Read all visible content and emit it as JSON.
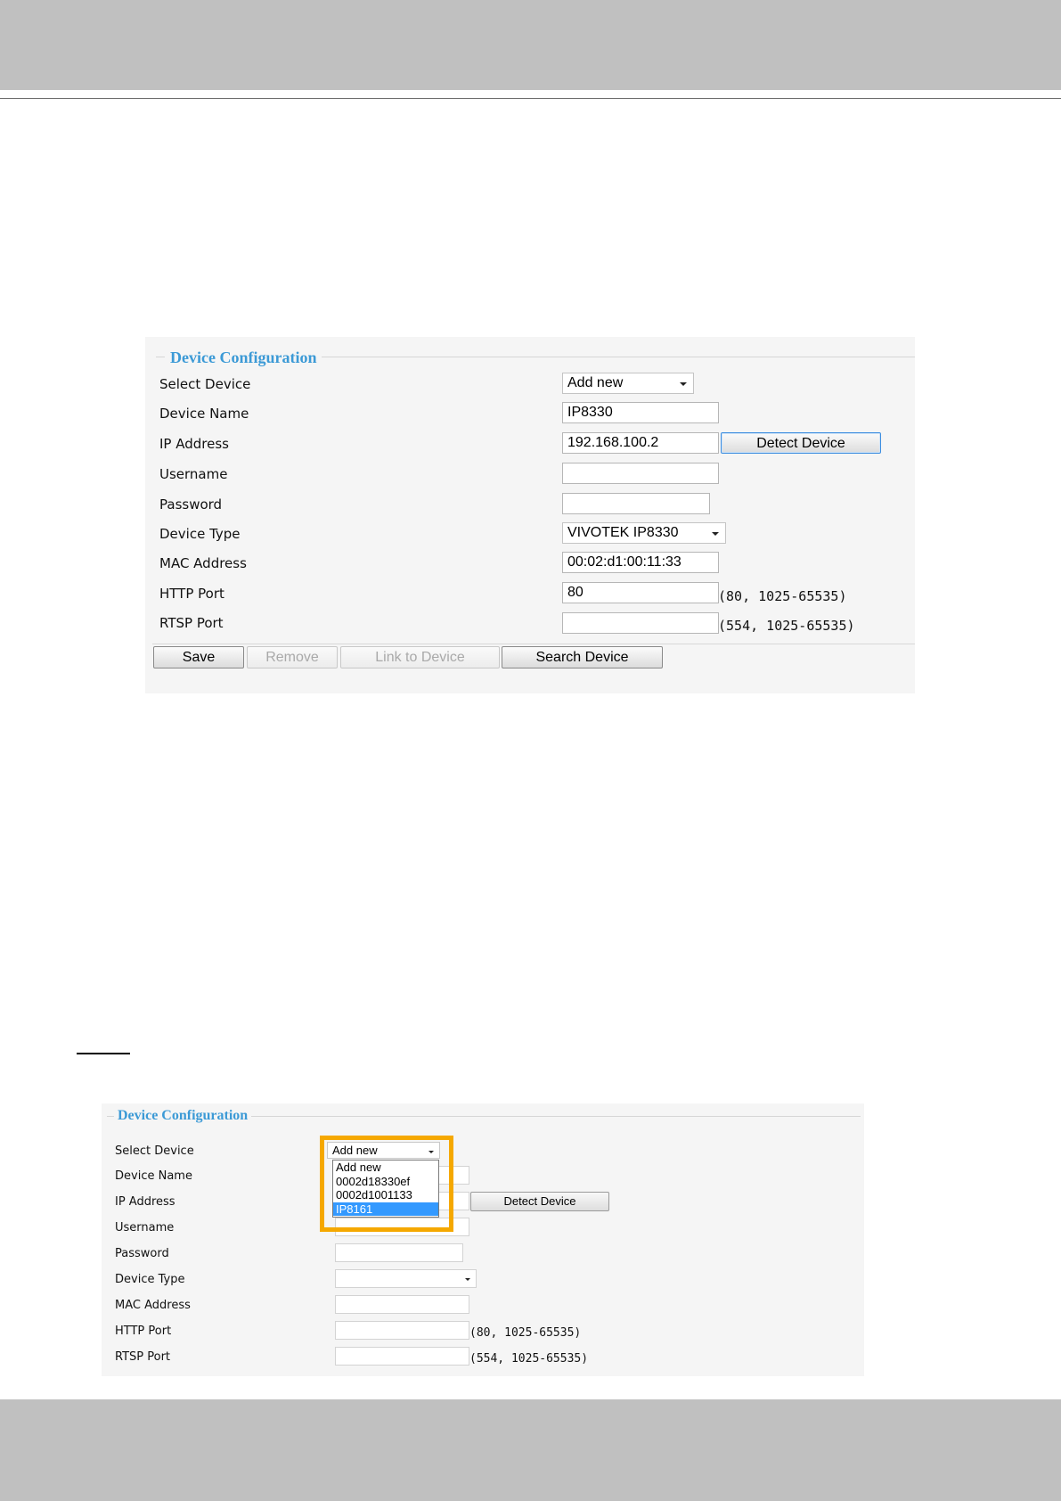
{
  "figure1": {
    "legend": "Device Configuration",
    "labels": {
      "select_device": "Select Device",
      "device_name": "Device Name",
      "ip_address": "IP Address",
      "username": "Username",
      "password": "Password",
      "device_type": "Device Type",
      "mac_address": "MAC Address",
      "http_port": "HTTP Port",
      "rtsp_port": "RTSP Port"
    },
    "values": {
      "select_device": "Add new",
      "device_name": "IP8330",
      "ip_address": "192.168.100.2",
      "username": "",
      "password": "",
      "device_type": "VIVOTEK IP8330",
      "mac_address": "00:02:d1:00:11:33",
      "http_port": "80",
      "rtsp_port": ""
    },
    "hints": {
      "http_port": "(80, 1025-65535)",
      "rtsp_port": "(554, 1025-65535)"
    },
    "buttons": {
      "detect_device": "Detect Device",
      "save": "Save",
      "remove": "Remove",
      "link_to_device": "Link to Device",
      "search_device": "Search Device"
    }
  },
  "figure2": {
    "legend": "Device Configuration",
    "labels": {
      "select_device": "Select Device",
      "device_name": "Device Name",
      "ip_address": "IP Address",
      "username": "Username",
      "password": "Password",
      "device_type": "Device Type",
      "mac_address": "MAC Address",
      "http_port": "HTTP Port",
      "rtsp_port": "RTSP Port"
    },
    "select_device_value": "Add new",
    "dropdown_options": [
      "Add new",
      "0002d18330ef",
      "0002d1001133",
      "IP8161"
    ],
    "dropdown_selected": "IP8161",
    "hints": {
      "http_port": "(80, 1025-65535)",
      "rtsp_port": "(554, 1025-65535)"
    },
    "buttons": {
      "detect_device": "Detect Device"
    },
    "highlight_color": "#f5a800"
  }
}
